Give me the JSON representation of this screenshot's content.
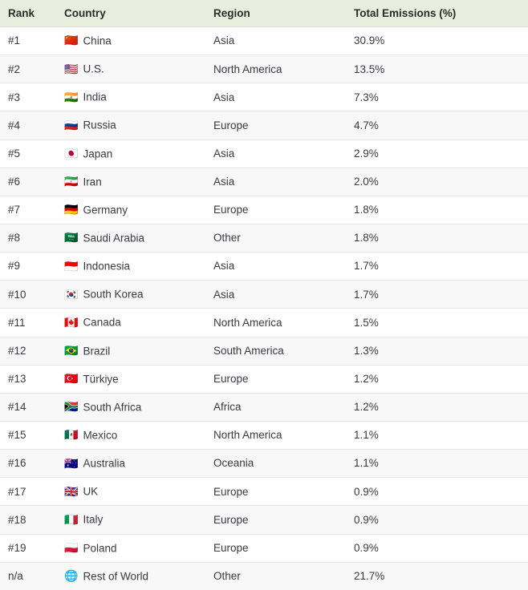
{
  "table": {
    "columns": [
      {
        "key": "rank",
        "label": "Rank"
      },
      {
        "key": "country",
        "label": "Country"
      },
      {
        "key": "region",
        "label": "Region"
      },
      {
        "key": "emis",
        "label": "Total Emissions (%)"
      }
    ],
    "header_background": "#e8eedd",
    "row_background_odd": "#ffffff",
    "row_background_even": "#f8f8f8",
    "rows": [
      {
        "rank": "#1",
        "flag": "flag-china-icon",
        "flag_glyph": "🇨🇳",
        "country": "China",
        "region": "Asia",
        "emis": "30.9%"
      },
      {
        "rank": "#2",
        "flag": "flag-united-states-icon",
        "flag_glyph": "🇺🇸",
        "country": "U.S.",
        "region": "North America",
        "emis": "13.5%"
      },
      {
        "rank": "#3",
        "flag": "flag-india-icon",
        "flag_glyph": "🇮🇳",
        "country": "India",
        "region": "Asia",
        "emis": "7.3%"
      },
      {
        "rank": "#4",
        "flag": "flag-russia-icon",
        "flag_glyph": "🇷🇺",
        "country": "Russia",
        "region": "Europe",
        "emis": "4.7%"
      },
      {
        "rank": "#5",
        "flag": "flag-japan-icon",
        "flag_glyph": "🇯🇵",
        "country": "Japan",
        "region": "Asia",
        "emis": "2.9%"
      },
      {
        "rank": "#6",
        "flag": "flag-iran-icon",
        "flag_glyph": "🇮🇷",
        "country": "Iran",
        "region": "Asia",
        "emis": "2.0%"
      },
      {
        "rank": "#7",
        "flag": "flag-germany-icon",
        "flag_glyph": "🇩🇪",
        "country": "Germany",
        "region": "Europe",
        "emis": "1.8%"
      },
      {
        "rank": "#8",
        "flag": "flag-saudi-arabia-icon",
        "flag_glyph": "🇸🇦",
        "country": "Saudi Arabia",
        "region": "Other",
        "emis": "1.8%"
      },
      {
        "rank": "#9",
        "flag": "flag-indonesia-icon",
        "flag_glyph": "🇮🇩",
        "country": "Indonesia",
        "region": "Asia",
        "emis": "1.7%"
      },
      {
        "rank": "#10",
        "flag": "flag-south-korea-icon",
        "flag_glyph": "🇰🇷",
        "country": "South Korea",
        "region": "Asia",
        "emis": "1.7%"
      },
      {
        "rank": "#11",
        "flag": "flag-canada-icon",
        "flag_glyph": "🇨🇦",
        "country": "Canada",
        "region": "North America",
        "emis": "1.5%"
      },
      {
        "rank": "#12",
        "flag": "flag-brazil-icon",
        "flag_glyph": "🇧🇷",
        "country": "Brazil",
        "region": "South America",
        "emis": "1.3%"
      },
      {
        "rank": "#13",
        "flag": "flag-turkiye-icon",
        "flag_glyph": "🇹🇷",
        "country": "Türkiye",
        "region": "Europe",
        "emis": "1.2%"
      },
      {
        "rank": "#14",
        "flag": "flag-south-africa-icon",
        "flag_glyph": "🇿🇦",
        "country": "South Africa",
        "region": "Africa",
        "emis": "1.2%"
      },
      {
        "rank": "#15",
        "flag": "flag-mexico-icon",
        "flag_glyph": "🇲🇽",
        "country": "Mexico",
        "region": "North America",
        "emis": "1.1%"
      },
      {
        "rank": "#16",
        "flag": "flag-australia-icon",
        "flag_glyph": "🇦🇺",
        "country": "Australia",
        "region": "Oceania",
        "emis": "1.1%"
      },
      {
        "rank": "#17",
        "flag": "flag-united-kingdom-icon",
        "flag_glyph": "🇬🇧",
        "country": "UK",
        "region": "Europe",
        "emis": "0.9%"
      },
      {
        "rank": "#18",
        "flag": "flag-italy-icon",
        "flag_glyph": "🇮🇹",
        "country": "Italy",
        "region": "Europe",
        "emis": "0.9%"
      },
      {
        "rank": "#19",
        "flag": "flag-poland-icon",
        "flag_glyph": "🇵🇱",
        "country": "Poland",
        "region": "Europe",
        "emis": "0.9%"
      },
      {
        "rank": "n/a",
        "flag": "globe-icon",
        "flag_glyph": "🌐",
        "country": "Rest of World",
        "region": "Other",
        "emis": "21.7%"
      }
    ]
  },
  "chart_data": {
    "type": "table",
    "title": "Total Emissions (%) by Country",
    "columns": [
      "Rank",
      "Country",
      "Region",
      "Total Emissions (%)"
    ],
    "categories": [
      "China",
      "U.S.",
      "India",
      "Russia",
      "Japan",
      "Iran",
      "Germany",
      "Saudi Arabia",
      "Indonesia",
      "South Korea",
      "Canada",
      "Brazil",
      "Türkiye",
      "South Africa",
      "Mexico",
      "Australia",
      "UK",
      "Italy",
      "Poland",
      "Rest of World"
    ],
    "values": [
      30.9,
      13.5,
      7.3,
      4.7,
      2.9,
      2.0,
      1.8,
      1.8,
      1.7,
      1.7,
      1.5,
      1.3,
      1.2,
      1.2,
      1.1,
      1.1,
      0.9,
      0.9,
      0.9,
      21.7
    ],
    "ylabel": "Total Emissions (%)",
    "xlabel": "Country"
  }
}
